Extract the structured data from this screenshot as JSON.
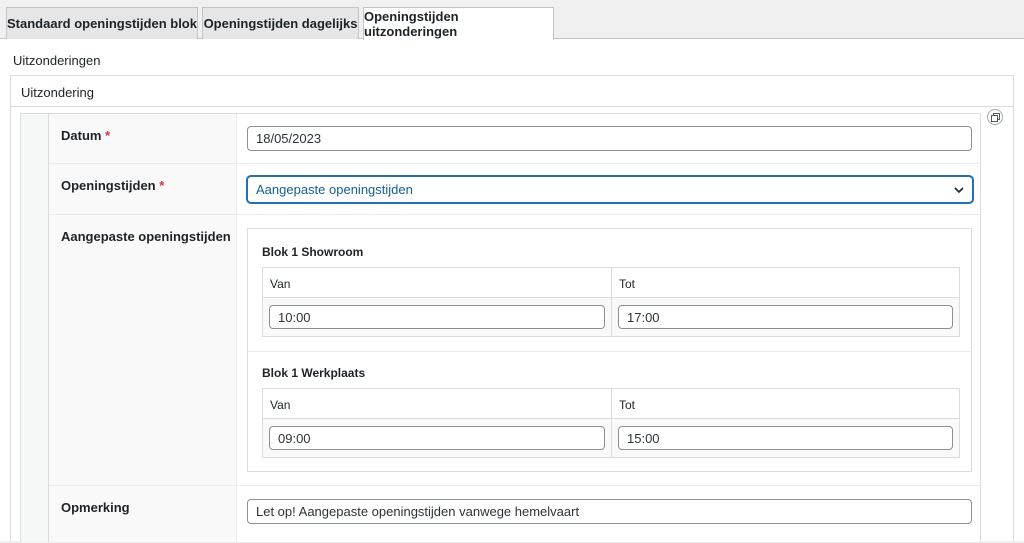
{
  "tabs": [
    {
      "label": "Standaard openingstijden blok",
      "active": false
    },
    {
      "label": "Openingstijden dagelijks",
      "active": false
    },
    {
      "label": "Openingstijden uitzonderingen",
      "active": true
    }
  ],
  "section": {
    "title": "Uitzonderingen"
  },
  "box": {
    "title": "Uitzondering"
  },
  "icons": {
    "duplicate": "duplicate-icon",
    "chevron": "chevron-down-icon"
  },
  "colors": {
    "required": "#d63638",
    "focus": "#2271b1"
  },
  "fields": {
    "datum": {
      "label": "Datum",
      "required": "*",
      "value": "18/05/2023"
    },
    "openingstijden": {
      "label": "Openingstijden",
      "required": "*",
      "value": "Aangepaste openingstijden"
    },
    "aangepast": {
      "label": "Aangepaste openingstijden",
      "blocks": [
        {
          "title": "Blok 1 Showroom",
          "van_label": "Van",
          "tot_label": "Tot",
          "van": "10:00",
          "tot": "17:00"
        },
        {
          "title": "Blok 1 Werkplaats",
          "van_label": "Van",
          "tot_label": "Tot",
          "van": "09:00",
          "tot": "15:00"
        }
      ]
    },
    "opmerking": {
      "label": "Opmerking",
      "value": "Let op! Aangepaste openingstijden vanwege hemelvaart"
    }
  }
}
